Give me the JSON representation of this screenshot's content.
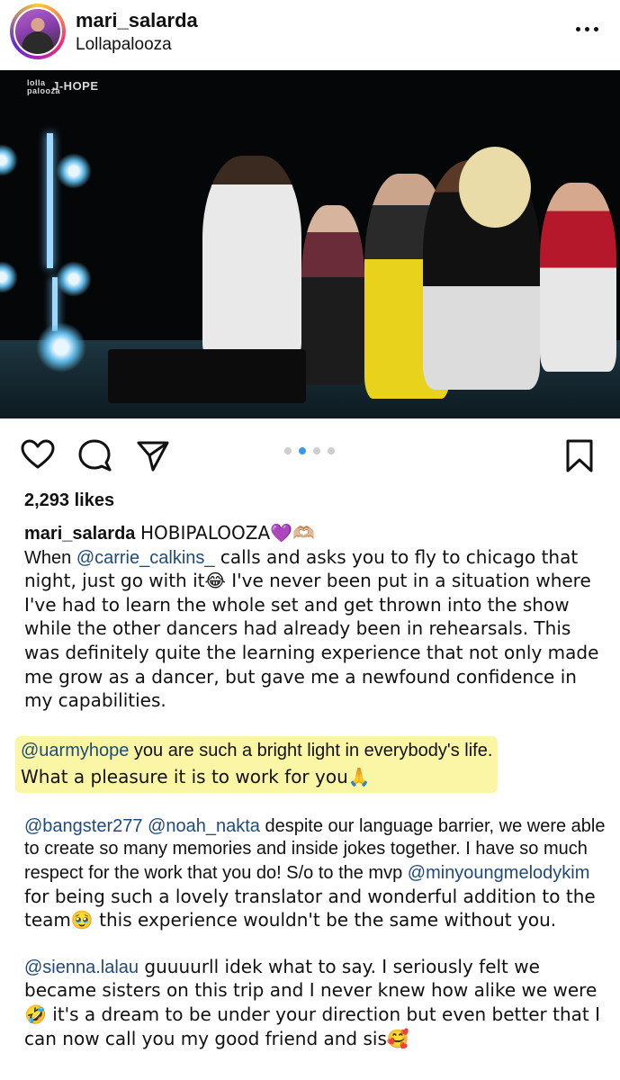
{
  "header": {
    "username": "mari_salarda",
    "location": "Lollapalooza"
  },
  "media": {
    "watermark_logo": "lolla palooza",
    "watermark_artist": "J-HOPE",
    "carousel_count": 4,
    "carousel_active_index": 1
  },
  "actions": {
    "like_icon": "heart-icon",
    "comment_icon": "comment-icon",
    "share_icon": "paper-plane-icon",
    "save_icon": "bookmark-icon",
    "accent_color": "#3897f0"
  },
  "likes": "2,293 likes",
  "caption": {
    "username": "mari_salarda",
    "headline": "HOBIPALOOZA💜🫶🏼",
    "p1_pre": "When ",
    "p1_mention": "@carrie_calkins_",
    "p1_post": " calls and asks you to fly to chicago that night, just go with it😂 I've never been put in a situation where I've had to learn the whole set and get thrown into the show while the other dancers had already been in rehearsals. This was definitely quite the learning experience that not only made me grow as a dancer, but gave me a newfound confidence in my capabilities.",
    "p2_mention": "@uarmyhope",
    "p2_line1": " you are such a bright light in everybody's life.",
    "p2_line2": "What a pleasure it is to work for you🙏",
    "highlight_color": "#fbf6a6",
    "p3_mention1": "@bangster277",
    "p3_mention2": "@noah_nakta",
    "p3_text1": " despite our language barrier, we were able to create so many memories and inside jokes together. I have so much respect for the work that you do! S/o to the mvp ",
    "p3_mention3": "@minyoungmelodykim",
    "p3_text2": " for being such a lovely translator and wonderful addition to the team🥹 this experience wouldn't be the same without you.",
    "p4_mention": "@sienna.lalau",
    "p4_text": " guuuurll idek what to say. I seriously felt we became sisters on this trip and I never knew how alike we were 🤣 it's a dream to be under your direction but even better that I can now call you my good friend and sis🥰"
  }
}
